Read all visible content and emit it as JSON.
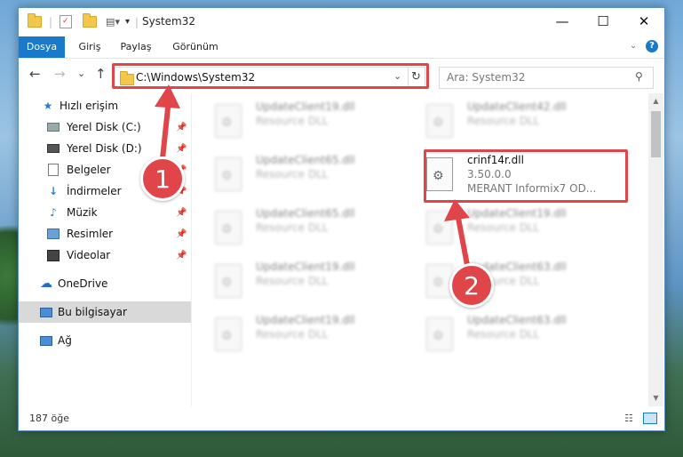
{
  "window": {
    "title": "System32",
    "minimize_glyph": "—",
    "maximize_glyph": "☐",
    "close_glyph": "✕"
  },
  "ribbon": {
    "tabs": [
      "Dosya",
      "Giriş",
      "Paylaş",
      "Görünüm"
    ]
  },
  "nav": {
    "back_glyph": "←",
    "forward_glyph": "→",
    "recent_glyph": "⌄",
    "up_glyph": "↑",
    "address": "C:\\Windows\\System32",
    "search_placeholder": "Ara: System32"
  },
  "sidebar": {
    "items": [
      {
        "label": "Hızlı erişim",
        "icon": "star-icon"
      },
      {
        "label": "Yerel Disk (C:)",
        "icon": "drive-icon",
        "pinned": true
      },
      {
        "label": "Yerel Disk (D:)",
        "icon": "drive-icon",
        "pinned": true
      },
      {
        "label": "Belgeler",
        "icon": "documents-icon",
        "pinned": true
      },
      {
        "label": "İndirmeler",
        "icon": "download-icon",
        "pinned": true
      },
      {
        "label": "Müzik",
        "icon": "music-icon",
        "pinned": true
      },
      {
        "label": "Resimler",
        "icon": "pictures-icon",
        "pinned": true
      },
      {
        "label": "Videolar",
        "icon": "videos-icon",
        "pinned": true
      },
      {
        "label": "OneDrive",
        "icon": "onedrive-icon"
      },
      {
        "label": "Bu bilgisayar",
        "icon": "computer-icon",
        "selected": true
      },
      {
        "label": "Ağ",
        "icon": "network-icon"
      }
    ]
  },
  "files": [
    {
      "name": "UpdateClient19.dll",
      "line2": "Resource DLL",
      "line3": "",
      "blurred": true
    },
    {
      "name": "UpdateClient42.dll",
      "line2": "Resource DLL",
      "line3": "",
      "blurred": true
    },
    {
      "name": "UpdateClient65.dll",
      "line2": "Resource DLL",
      "line3": "",
      "blurred": true
    },
    {
      "name": "crinf14r.dll",
      "line2": "3.50.0.0",
      "line3": "MERANT Informix7 OD...",
      "blurred": false
    },
    {
      "name": "UpdateClient65.dll",
      "line2": "Resource DLL",
      "line3": "",
      "blurred": true
    },
    {
      "name": "UpdateClient19.dll",
      "line2": "Resource DLL",
      "line3": "",
      "blurred": true
    },
    {
      "name": "UpdateClient19.dll",
      "line2": "Resource DLL",
      "line3": "",
      "blurred": true
    },
    {
      "name": "UpdateClient63.dll",
      "line2": "Resource DLL",
      "line3": "",
      "blurred": true
    },
    {
      "name": "UpdateClient19.dll",
      "line2": "Resource DLL",
      "line3": "",
      "blurred": true
    },
    {
      "name": "UpdateClient63.dll",
      "line2": "Resource DLL",
      "line3": "",
      "blurred": true
    }
  ],
  "status": {
    "count": "187 öğe"
  },
  "annotations": {
    "step1": "1",
    "step2": "2",
    "color": "#e0454a"
  }
}
